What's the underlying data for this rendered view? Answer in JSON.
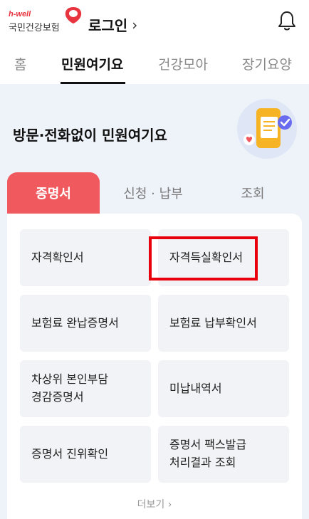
{
  "header": {
    "logo_top": "h-well",
    "logo_main": "국민건강보험",
    "login_label": "로그인",
    "login_chevron": "›",
    "notification_icon": "bell-icon"
  },
  "nav": {
    "items": [
      {
        "label": "홈"
      },
      {
        "label": "민원여기요",
        "active": true
      },
      {
        "label": "건강모아"
      },
      {
        "label": "장기요양"
      }
    ]
  },
  "main": {
    "title": "방문·전화없이 민원여기요",
    "illustration": "phone-document-icon",
    "tabs": [
      {
        "label": "증명서",
        "active": true
      },
      {
        "label": "신청 · 납부"
      },
      {
        "label": "조회"
      }
    ],
    "cells": [
      {
        "label": "자격확인서"
      },
      {
        "label": "자격득실확인서"
      },
      {
        "label": "보험료 완납증명서"
      },
      {
        "label": "보험료 납부확인서"
      },
      {
        "label": "차상위 본인부담\n경감증명서"
      },
      {
        "label": "미납내역서"
      },
      {
        "label": "증명서 진위확인"
      },
      {
        "label": "증명서 팩스발급\n처리결과 조회"
      }
    ],
    "more_label": "더보기 ›"
  },
  "colors": {
    "accent": "#f05a5e",
    "highlight": "#e8000d",
    "background": "#eef2f9"
  }
}
